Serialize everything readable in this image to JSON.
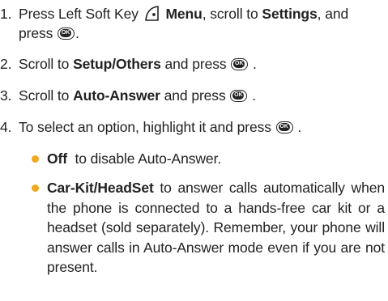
{
  "steps": [
    {
      "num": "1.",
      "t1": "Press Left Soft Key",
      "b1": "Menu",
      "t2": ", scroll to",
      "b2": "Settings",
      "t3": ", and",
      "t4": "press",
      "t5": "."
    },
    {
      "num": "2.",
      "t1": "Scroll to",
      "b1": "Setup/Others",
      "t2": "and press",
      "t3": "."
    },
    {
      "num": "3.",
      "t1": "Scroll to",
      "b1": "Auto-Answer",
      "t2": "and press",
      "t3": "."
    },
    {
      "num": "4.",
      "t1": "To select an option, highlight it and press",
      "t2": "."
    }
  ],
  "options": [
    {
      "name": "Off",
      "desc": "to disable Auto-Answer."
    },
    {
      "name": "Car-Kit/HeadSet",
      "desc": "to answer calls automatically when the phone is connected to a hands-free car kit or a headset (sold separately). Remember, your phone will answer calls in Auto-Answer mode even if you are not present."
    }
  ],
  "ok_key_label": "OK",
  "colors": {
    "bullet": "#f0a81c",
    "text": "#222222"
  },
  "icons": {
    "soft_key": "left-soft-key-icon",
    "ok_key": "ok-key-icon"
  }
}
